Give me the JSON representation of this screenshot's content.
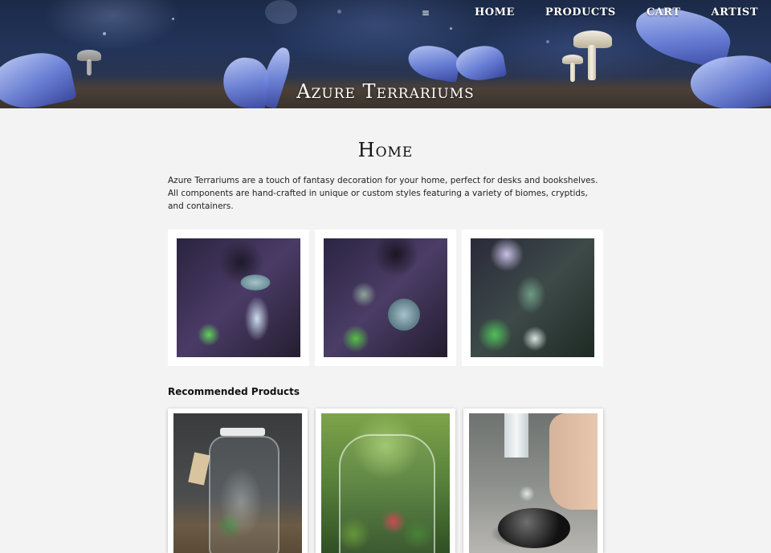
{
  "header": {
    "site_title": "Azure Terrariums",
    "nav": {
      "menu_icon": "≡",
      "links": [
        "HOME",
        "PRODUCTS",
        "CART",
        "ARTIST"
      ]
    }
  },
  "main": {
    "page_title": "Home",
    "intro": "Azure Terrariums are a touch of fantasy decoration for your home, perfect for desks and bookshelves. All components are hand-crafted in unique or custom styles featuring a variety of biomes, cryptids, and containers.",
    "gallery": [
      {
        "icon": "terrarium-mushroom-lamp-image"
      },
      {
        "icon": "terrarium-orb-lamp-image"
      },
      {
        "icon": "terrarium-crystal-image"
      }
    ],
    "recommended_title": "Recommended Products",
    "products": [
      {
        "icon": "jar-terrarium-deer-image"
      },
      {
        "icon": "glass-terrarium-plants-image"
      },
      {
        "icon": "terrarium-assembly-image"
      }
    ]
  }
}
